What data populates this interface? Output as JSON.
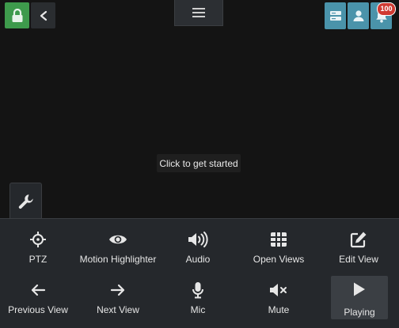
{
  "topbar": {
    "lock_icon": "lock-icon",
    "back_icon": "chevron-left-icon",
    "menu_icon": "hamburger-icon",
    "server_icon": "server-icon",
    "user_icon": "user-icon",
    "bell_icon": "bell-icon",
    "notification_count": "100"
  },
  "viewport": {
    "prompt": "Click to get started"
  },
  "toolbar": {
    "tab_icon": "wrench-icon",
    "row1": [
      {
        "label": "PTZ",
        "icon": "ptz-crosshair-icon"
      },
      {
        "label": "Motion Highlighter",
        "icon": "eye-icon"
      },
      {
        "label": "Audio",
        "icon": "speaker-icon"
      },
      {
        "label": "Open Views",
        "icon": "grid-icon"
      },
      {
        "label": "Edit View",
        "icon": "edit-icon"
      }
    ],
    "row2": [
      {
        "label": "Previous View",
        "icon": "arrow-left-icon"
      },
      {
        "label": "Next View",
        "icon": "arrow-right-icon"
      },
      {
        "label": "Mic",
        "icon": "microphone-icon"
      },
      {
        "label": "Mute",
        "icon": "mute-icon"
      },
      {
        "label": "Playing",
        "icon": "play-icon",
        "active": true
      }
    ]
  },
  "colors": {
    "lock_green": "#3e9a4c",
    "accent_blue": "#4a93aa",
    "badge_red": "#d03a32",
    "panel_bg": "#25282c",
    "viewport_bg": "#141414"
  }
}
